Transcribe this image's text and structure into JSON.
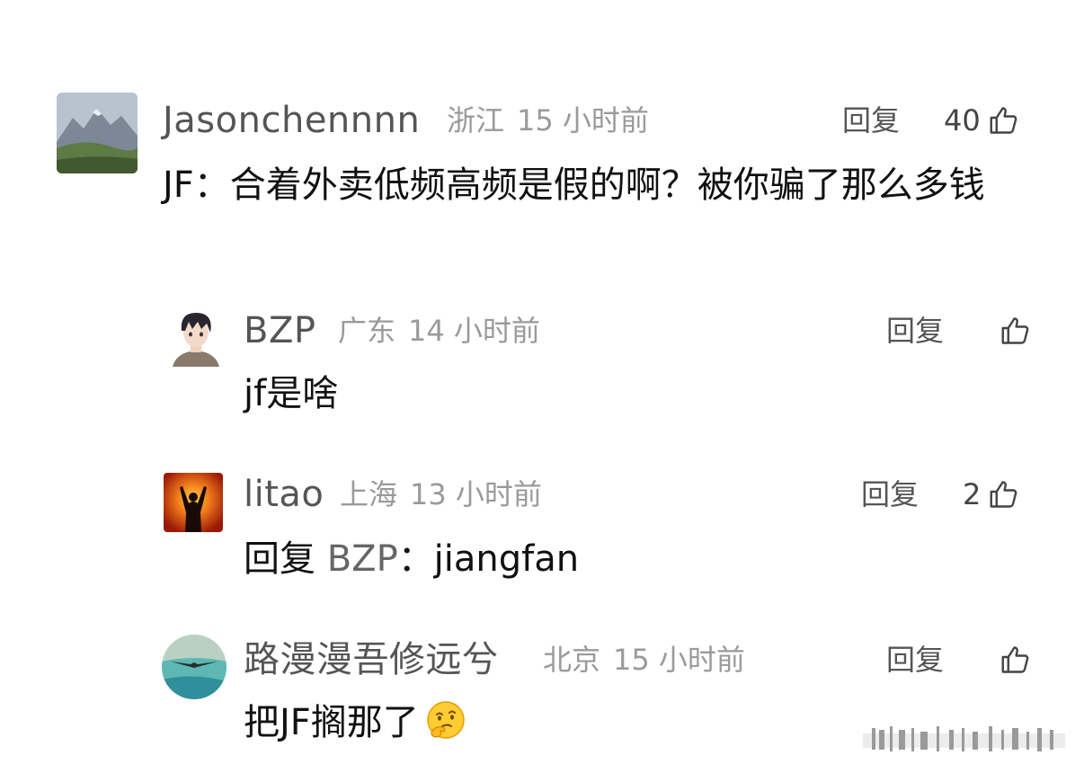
{
  "comments": [
    {
      "username": "Jasonchennnn",
      "location": "浙江",
      "time": "15 小时前",
      "reply_label": "回复",
      "likes": "40",
      "text": "JF：合着外卖低频高频是假的啊？被你骗了那么多钱",
      "avatar": "mountain-landscape-avatar"
    },
    {
      "username": "BZP",
      "location": "广东",
      "time": "14 小时前",
      "reply_label": "回复",
      "likes": "",
      "text": "jf是啥",
      "avatar": "anime-boy-avatar"
    },
    {
      "username": "litao",
      "location": "上海",
      "time": "13 小时前",
      "reply_label": "回复",
      "likes": "2",
      "text_prefix": "回复 ",
      "mention": "BZP",
      "text": "：jiangfan",
      "avatar": "sunset-silhouette-avatar"
    },
    {
      "username": "路漫漫吾修远兮",
      "location": "北京",
      "time": "15 小时前",
      "reply_label": "回复",
      "likes": "",
      "text": "把JF搁那了",
      "emoji": "thinking-face-emoji",
      "avatar": "bird-over-water-avatar"
    }
  ],
  "icons": {
    "like": "thumbs-up-icon"
  },
  "colors": {
    "username": "#555555",
    "meta": "#9a9a9a",
    "text": "#111111",
    "mention": "#666666"
  }
}
